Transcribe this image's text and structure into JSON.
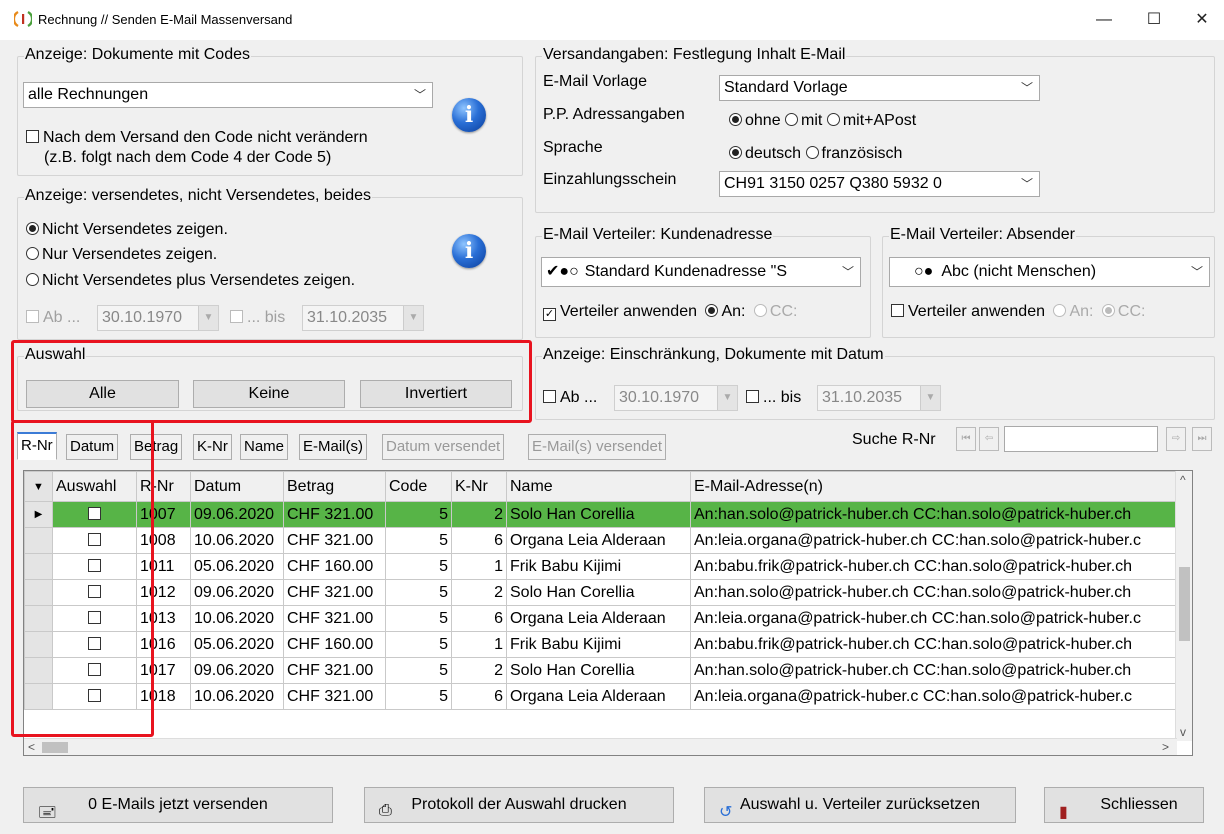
{
  "window": {
    "title": "Rechnung // Senden E-Mail Massenversand",
    "minimize": "—",
    "maximize": "☐",
    "close": "✕"
  },
  "filter_codes": {
    "title": "Anzeige: Dokumente mit Codes",
    "selected": "alle Rechnungen",
    "keep_code_label": "Nach dem Versand den Code nicht verändern",
    "keep_code_hint": "(z.B. folgt nach dem Code 4 der Code 5)"
  },
  "filter_sent": {
    "title": "Anzeige: versendetes, nicht Versendetes, beides",
    "options": [
      "Nicht Versendetes zeigen.",
      "Nur Versendetes zeigen.",
      "Nicht Versendetes plus Versendetes zeigen."
    ],
    "from_label": "Ab ...",
    "from_date": "30.10.1970",
    "to_label": "... bis",
    "to_date": "31.10.2035"
  },
  "versand": {
    "title": "Versandangaben: Festlegung Inhalt E-Mail",
    "template_label": "E-Mail Vorlage",
    "template_value": "Standard Vorlage",
    "pp_label": "P.P. Adressangaben",
    "pp_options": [
      "ohne",
      "mit",
      "mit+APost"
    ],
    "lang_label": "Sprache",
    "lang_options": [
      "deutsch",
      "französisch"
    ],
    "slip_label": "Einzahlungsschein",
    "slip_value": "CH91 3150 0257 Q380 5932 0"
  },
  "distributor_customer": {
    "title": "E-Mail Verteiler: Kundenadresse",
    "marks": "✔●○",
    "value": "Standard Kundenadresse \"S",
    "apply_label": "Verteiler anwenden",
    "to_label": "An:",
    "cc_label": "CC:"
  },
  "distributor_sender": {
    "title": "E-Mail Verteiler: Absender",
    "marks": "○●",
    "value": "Abc (nicht Menschen)",
    "apply_label": "Verteiler anwenden",
    "to_label": "An:",
    "cc_label": "CC:"
  },
  "selection": {
    "title": "Auswahl",
    "all": "Alle",
    "none": "Keine",
    "invert": "Invertiert"
  },
  "date_filter": {
    "title": "Anzeige: Einschränkung, Dokumente mit Datum",
    "from_label": "Ab ...",
    "from_date": "30.10.1970",
    "to_label": "... bis",
    "to_date": "31.10.2035"
  },
  "tabs": [
    "R-Nr",
    "Datum",
    "Betrag",
    "K-Nr",
    "Name",
    "E-Mail(s)",
    "Datum versendet",
    "E-Mail(s) versendet"
  ],
  "search": {
    "label": "Suche R-Nr",
    "value": ""
  },
  "grid": {
    "headers": [
      "Auswahl",
      "R-Nr",
      "Datum",
      "Betrag",
      "Code",
      "K-Nr",
      "Name",
      "E-Mail-Adresse(n)"
    ],
    "rows": [
      [
        "1007",
        "09.06.2020",
        "CHF 321.00",
        "5",
        "2",
        "Solo Han Corellia",
        "An:han.solo@patrick-huber.ch CC:han.solo@patrick-huber.ch"
      ],
      [
        "1008",
        "10.06.2020",
        "CHF 321.00",
        "5",
        "6",
        "Organa Leia Alderaan",
        "An:leia.organa@patrick-huber.ch CC:han.solo@patrick-huber.c"
      ],
      [
        "1011",
        "05.06.2020",
        "CHF 160.00",
        "5",
        "1",
        "Frik Babu Kijimi",
        "An:babu.frik@patrick-huber.ch CC:han.solo@patrick-huber.ch"
      ],
      [
        "1012",
        "09.06.2020",
        "CHF 321.00",
        "5",
        "2",
        "Solo Han Corellia",
        "An:han.solo@patrick-huber.ch CC:han.solo@patrick-huber.ch"
      ],
      [
        "1013",
        "10.06.2020",
        "CHF 321.00",
        "5",
        "6",
        "Organa Leia Alderaan",
        "An:leia.organa@patrick-huber.ch CC:han.solo@patrick-huber.c"
      ],
      [
        "1016",
        "05.06.2020",
        "CHF 160.00",
        "5",
        "1",
        "Frik Babu Kijimi",
        "An:babu.frik@patrick-huber.ch CC:han.solo@patrick-huber.ch"
      ],
      [
        "1017",
        "09.06.2020",
        "CHF 321.00",
        "5",
        "2",
        "Solo Han Corellia",
        "An:han.solo@patrick-huber.ch CC:han.solo@patrick-huber.ch"
      ],
      [
        "1018",
        "10.06.2020",
        "CHF 321.00",
        "5",
        "6",
        "Organa Leia Alderaan",
        "An:leia.organa@patrick-huber.c CC:han.solo@patrick-huber.c"
      ]
    ]
  },
  "footer": {
    "send": "0 E-Mails jetzt versenden",
    "print": "Protokoll der Auswahl drucken",
    "reset": "Auswahl u. Verteiler zurücksetzen",
    "close": "Schliessen"
  },
  "colors": {
    "selected_row": "#57b447",
    "highlight": "#e8131f"
  }
}
